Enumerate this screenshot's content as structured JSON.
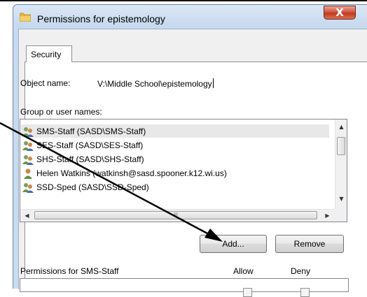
{
  "window": {
    "title": "Permissions for epistemology",
    "close_label": "X"
  },
  "tabs": [
    {
      "label": "Security"
    }
  ],
  "object": {
    "label": "Object name:",
    "value": "V:\\Middle School\\epistemology"
  },
  "group_list": {
    "label": "Group or user names:",
    "items": [
      {
        "name": "SMS-Staff (SASD\\SMS-Staff)",
        "icon": "group-icon",
        "selected": true
      },
      {
        "name": "SES-Staff (SASD\\SES-Staff)",
        "icon": "group-icon",
        "selected": false
      },
      {
        "name": "SHS-Staff (SASD\\SHS-Staff)",
        "icon": "group-icon",
        "selected": false
      },
      {
        "name": "Helen Watkins (watkinsh@sasd.spooner.k12.wi.us)",
        "icon": "user-icon",
        "selected": false
      },
      {
        "name": "SSD-Sped (SASD\\SSD-Sped)",
        "icon": "group-icon",
        "selected": false
      }
    ],
    "scroll_up": "▲",
    "scroll_down": "▼",
    "scroll_left": "◀",
    "scroll_right": "▶",
    "thumb_grip": "III"
  },
  "buttons": {
    "add": "Add...",
    "remove": "Remove"
  },
  "permissions": {
    "label": "Permissions for SMS-Staff",
    "allow": "Allow",
    "deny": "Deny"
  },
  "colors": {
    "close_button": "#c0391d",
    "window_frame": "#c7d9ee",
    "folder": "#e6b43c"
  }
}
